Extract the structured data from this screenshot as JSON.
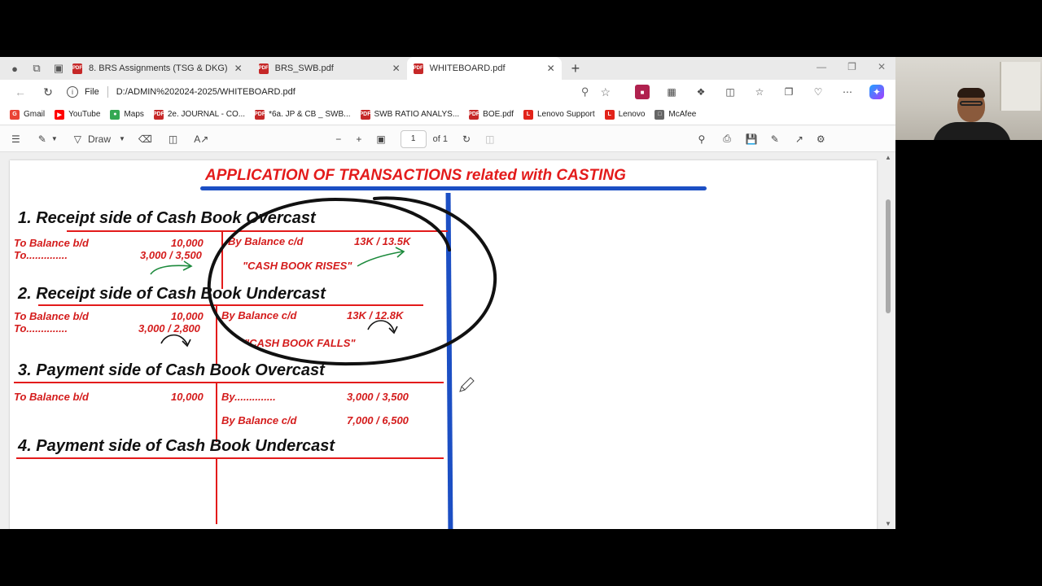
{
  "tabs": [
    {
      "label": "8. BRS Assignments (TSG & DKG)",
      "active": false
    },
    {
      "label": "BRS_SWB.pdf",
      "active": false
    },
    {
      "label": "WHITEBOARD.pdf",
      "active": true
    }
  ],
  "address": {
    "scheme_label": "File",
    "url": "D:/ADMIN%202024-2025/WHITEBOARD.pdf"
  },
  "bookmarks": [
    {
      "label": "Gmail",
      "icon": "gmail-icon",
      "color": "#ea4335"
    },
    {
      "label": "YouTube",
      "icon": "youtube-icon",
      "color": "#ff0000"
    },
    {
      "label": "Maps",
      "icon": "maps-icon",
      "color": "#34a853"
    },
    {
      "label": "2e. JOURNAL - CO...",
      "icon": "pdf-icon",
      "color": "#c62828"
    },
    {
      "label": "*6a. JP & CB _ SWB...",
      "icon": "pdf-icon",
      "color": "#c62828"
    },
    {
      "label": "SWB RATIO ANALYS...",
      "icon": "pdf-icon",
      "color": "#c62828"
    },
    {
      "label": "BOE.pdf",
      "icon": "pdf-icon",
      "color": "#c62828"
    },
    {
      "label": "Lenovo Support",
      "icon": "lenovo-icon",
      "color": "#e2231a"
    },
    {
      "label": "Lenovo",
      "icon": "lenovo-icon",
      "color": "#e2231a"
    },
    {
      "label": "McAfee",
      "icon": "page-icon",
      "color": "#666666"
    }
  ],
  "pdf_toolbar": {
    "draw_label": "Draw",
    "page_number": "1",
    "page_total": "of 1"
  },
  "document": {
    "title": "APPLICATION OF TRANSACTIONS related with CASTING",
    "sections": [
      {
        "heading": "1.   Receipt side of Cash Book Overcast",
        "left": [
          {
            "label": "To Balance b/d",
            "amount": "10,000"
          },
          {
            "label": "To..............",
            "amount": "3,000 / 3,500"
          }
        ],
        "right": [
          {
            "label": "By Balance c/d",
            "amount": "13K / 13.5K"
          }
        ],
        "note": "\"CASH BOOK RISES\""
      },
      {
        "heading": "2.   Receipt side of Cash Book Undercast",
        "left": [
          {
            "label": "To Balance b/d",
            "amount": "10,000"
          },
          {
            "label": "To..............",
            "amount": "3,000 / 2,800"
          }
        ],
        "right": [
          {
            "label": "By Balance c/d",
            "amount": "13K  /  12.8K"
          }
        ],
        "note": "\"CASH BOOK FALLS\""
      },
      {
        "heading": "3.   Payment side of Cash Book Overcast",
        "left": [
          {
            "label": "To Balance b/d",
            "amount": "10,000"
          }
        ],
        "right": [
          {
            "label": "By..............",
            "amount": "3,000 / 3,500"
          },
          {
            "label": "By Balance c/d",
            "amount": "7,000 / 6,500"
          }
        ]
      },
      {
        "heading": "4.   Payment side of Cash Book Undercast"
      }
    ]
  },
  "colors": {
    "accent_blue": "#1c4fc4",
    "text_red": "#d41c1c",
    "title_red": "#e31b1b"
  }
}
